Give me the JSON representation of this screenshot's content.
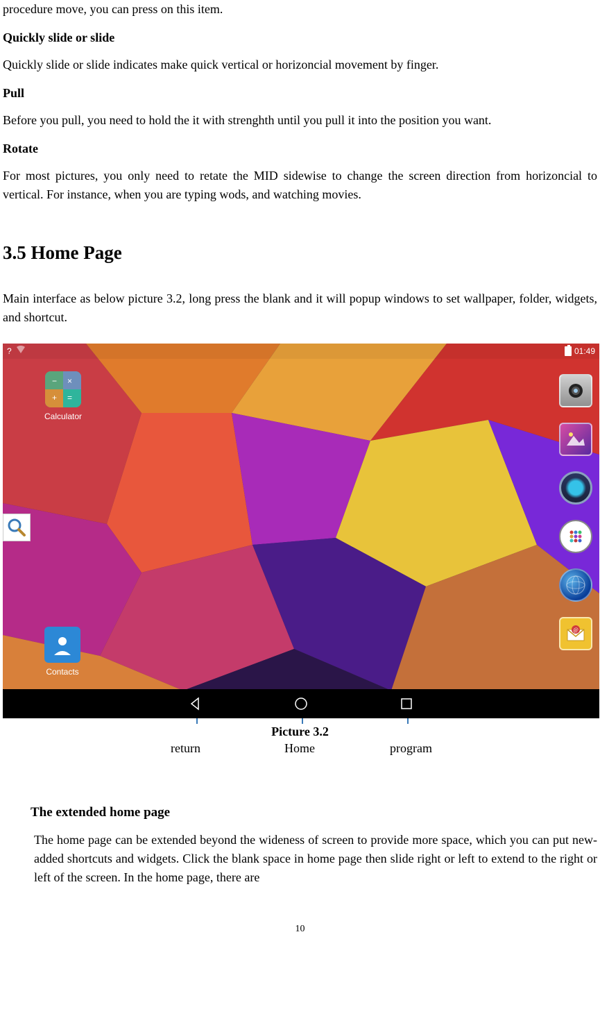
{
  "intro_para": "procedure move, you can press on this item.",
  "h_quickslide": "Quickly slide or slide",
  "p_quickslide": "Quickly slide or slide indicates make quick vertical or horizoncial movement by finger.",
  "h_pull": "Pull",
  "p_pull": "Before you pull, you need to hold the it with strenghth until you pull it into the position you want.",
  "h_rotate": "Rotate",
  "p_rotate": "For most pictures, you only need to retate the MID sidewise to change the screen direction from horizoncial to vertical. For instance, when you are typing wods, and watching movies.",
  "section_title": "3.5 Home Page",
  "section_body": "Main interface as below picture 3.2, long press the blank and it will popup windows to set wallpaper, folder, widgets, and shortcut.",
  "statusbar": {
    "time": "01:49",
    "debug": "?"
  },
  "apps": {
    "calculator": "Calculator",
    "contacts": "Contacts"
  },
  "figure_caption": "Picture 3.2",
  "labels": {
    "return": "return",
    "home": "Home",
    "program": "program"
  },
  "extended_heading": "The extended home page",
  "extended_body": "The home page can be extended beyond the wideness of screen to provide more space, which you can put new-added shortcuts and widgets. Click the blank space in home page then slide right or left to extend to the right or left of the screen. In the home page, there are",
  "page_number": "10"
}
